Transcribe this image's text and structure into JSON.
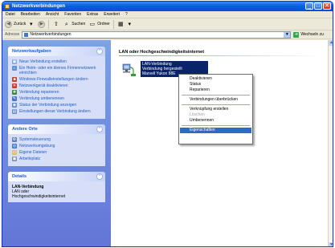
{
  "window": {
    "title": "Netzwerkverbindungen",
    "buttons": [
      "_",
      "□",
      "✕"
    ]
  },
  "menubar": [
    "Datei",
    "Bearbeiten",
    "Ansicht",
    "Favoriten",
    "Extras",
    "Erweitert",
    "?"
  ],
  "toolbar": {
    "back": "Zurück",
    "search": "Suchen",
    "folders": "Ordner"
  },
  "address": {
    "label": "Adresse",
    "value": "Netzwerkverbindungen",
    "go": "Wechseln zu"
  },
  "tasks_panel": {
    "title": "Netzwerkaufgaben",
    "items": [
      "Neue Verbindung erstellen",
      "Ein Heim- oder ein kleines Firmennetzwerk einrichten",
      "Windows-Firewalleinstellungen ändern",
      "Netzwerkgerät deaktivieren",
      "Verbindung reparieren",
      "Verbindung umbenennen",
      "Status der Verbindung anzeigen",
      "Einstellungen dieser Verbindung ändern"
    ]
  },
  "other_panel": {
    "title": "Andere Orte",
    "items": [
      "Systemsteuerung",
      "Netzwerkumgebung",
      "Eigene Dateien",
      "Arbeitsplatz"
    ]
  },
  "details_panel": {
    "title": "Details",
    "name": "LAN-Verbindung",
    "lines": [
      "LAN oder",
      "Hochgeschwindigkeitsinternet"
    ]
  },
  "main": {
    "group_header": "LAN oder Hochgeschwindigkeitsinternet",
    "connection": {
      "name": "LAN-Verbindung",
      "status": "Verbindung hergestellt",
      "adapter": "Marvell Yukon 88E"
    }
  },
  "context_menu": {
    "items": [
      {
        "label": "Deaktivieren",
        "disabled": false
      },
      {
        "label": "Status",
        "disabled": false
      },
      {
        "label": "Reparieren",
        "disabled": false
      },
      {
        "sep": true
      },
      {
        "label": "Verbindungen überbrücken",
        "disabled": false
      },
      {
        "sep": true
      },
      {
        "label": "Verknüpfung erstellen",
        "disabled": false
      },
      {
        "label": "Löschen",
        "disabled": true
      },
      {
        "label": "Umbenennen",
        "disabled": false
      },
      {
        "sep": true
      },
      {
        "label": "Eigenschaften",
        "disabled": false,
        "selected": true
      }
    ]
  },
  "colors": {
    "titlebar": "#0a5ee3",
    "task_link": "#215dc6",
    "selection": "#316ac5",
    "pane_gradient": "#6375d6"
  }
}
